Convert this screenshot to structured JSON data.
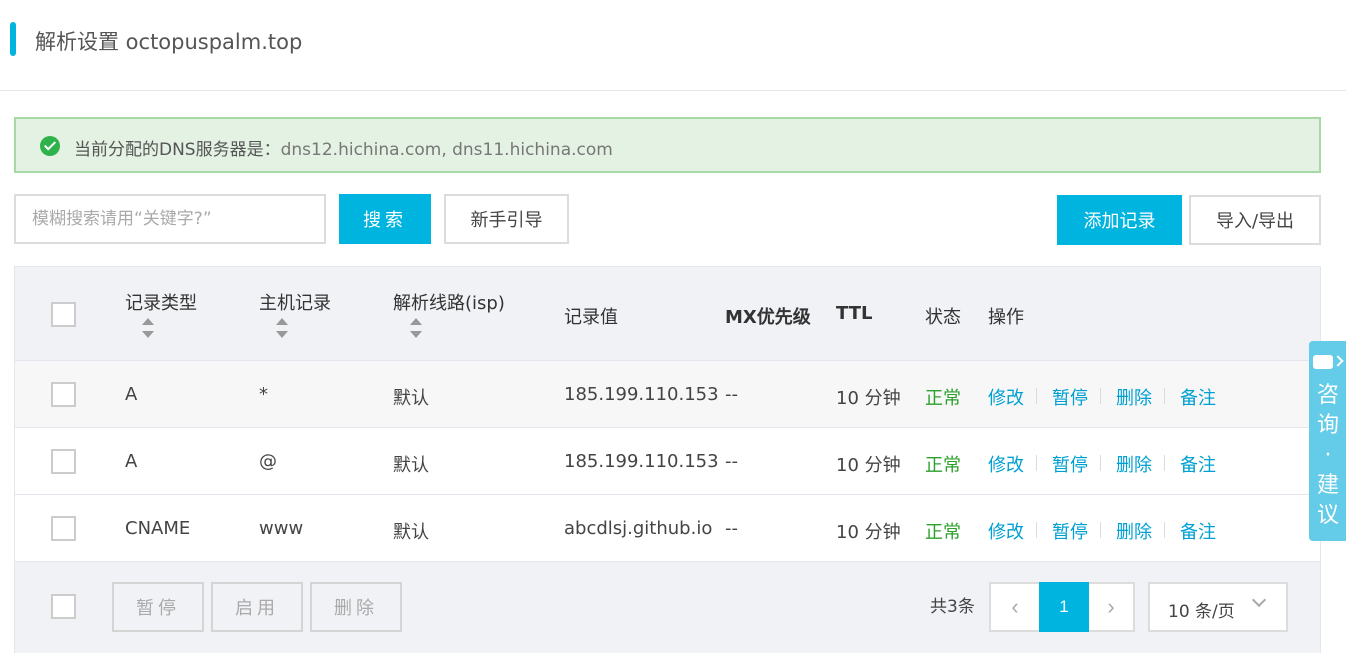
{
  "header": {
    "title": "解析设置 octopuspalm.top"
  },
  "dns_notice": {
    "prefix": "当前分配的DNS服务器是：",
    "servers": "dns12.hichina.com, dns11.hichina.com"
  },
  "toolbar": {
    "search_placeholder": "模糊搜索请用“关键字?”",
    "search_label": "搜索",
    "guide_label": "新手引导",
    "add_label": "添加记录",
    "import_export_label": "导入/导出"
  },
  "table": {
    "headers": {
      "type": "记录类型",
      "host": "主机记录",
      "line": "解析线路(isp)",
      "value": "记录值",
      "mx": "MX优先级",
      "ttl": "TTL",
      "status": "状态",
      "actions": "操作"
    },
    "rows": [
      {
        "type": "A",
        "host": "*",
        "line": "默认",
        "value": "185.199.110.153",
        "mx": "--",
        "ttl": "10 分钟",
        "status": "正常"
      },
      {
        "type": "A",
        "host": "@",
        "line": "默认",
        "value": "185.199.110.153",
        "mx": "--",
        "ttl": "10 分钟",
        "status": "正常"
      },
      {
        "type": "CNAME",
        "host": "www",
        "line": "默认",
        "value": "abcdlsj.github.io",
        "mx": "--",
        "ttl": "10 分钟",
        "status": "正常"
      }
    ],
    "actions": {
      "edit": "修改",
      "pause": "暂停",
      "delete": "删除",
      "note": "备注"
    }
  },
  "footer": {
    "bulk_pause": "暂停",
    "bulk_enable": "启用",
    "bulk_delete": "删除",
    "total": "共3条",
    "current_page": "1",
    "prev": "‹",
    "next": "›",
    "page_size": "10 条/页"
  },
  "side_widget": {
    "label": "咨询·建议"
  },
  "colors": {
    "accent": "#00b4e0",
    "success": "#2ca02c",
    "link": "#00a0d2",
    "banner_bg": "#e3f2e2"
  }
}
